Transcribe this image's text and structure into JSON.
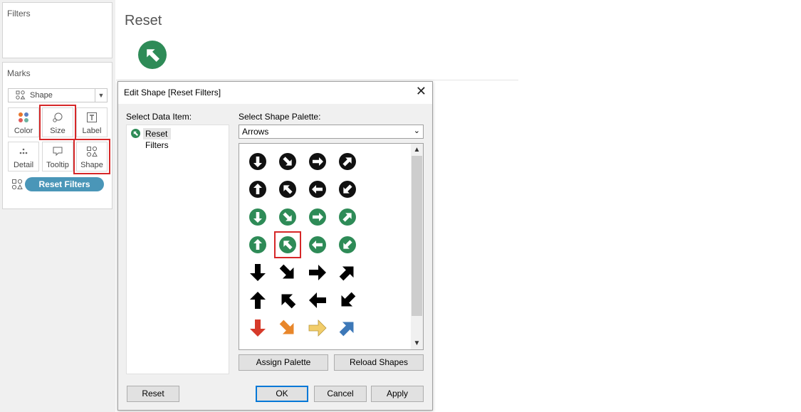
{
  "left_panel": {
    "filters_title": "Filters",
    "marks_title": "Marks",
    "mark_type": "Shape",
    "buttons": {
      "color": "Color",
      "size": "Size",
      "label": "Label",
      "detail": "Detail",
      "tooltip": "Tooltip",
      "shape": "Shape"
    },
    "pill_label": "Reset Filters"
  },
  "sheet": {
    "title": "Reset"
  },
  "dialog": {
    "title": "Edit Shape [Reset Filters]",
    "select_data_item_label": "Select Data Item:",
    "data_items": [
      "Reset Filters"
    ],
    "select_palette_label": "Select Shape Palette:",
    "palette_value": "Arrows",
    "buttons": {
      "assign_palette": "Assign Palette",
      "reload_shapes": "Reload Shapes",
      "reset": "Reset",
      "ok": "OK",
      "cancel": "Cancel",
      "apply": "Apply"
    }
  },
  "shapes": [
    {
      "name": "circle-arrow-down-black-icon",
      "style": "circle",
      "color": "#111111",
      "dir": 180
    },
    {
      "name": "circle-arrow-down-right-black-icon",
      "style": "circle",
      "color": "#111111",
      "dir": 135
    },
    {
      "name": "circle-arrow-right-black-icon",
      "style": "circle",
      "color": "#111111",
      "dir": 90
    },
    {
      "name": "circle-arrow-up-right-black-icon",
      "style": "circle",
      "color": "#111111",
      "dir": 45
    },
    {
      "name": "circle-arrow-up-black-icon",
      "style": "circle",
      "color": "#111111",
      "dir": 0
    },
    {
      "name": "circle-arrow-up-left-black-icon",
      "style": "circle",
      "color": "#111111",
      "dir": -45
    },
    {
      "name": "circle-arrow-left-black-icon",
      "style": "circle",
      "color": "#111111",
      "dir": -90
    },
    {
      "name": "circle-arrow-down-left-black-icon",
      "style": "circle",
      "color": "#111111",
      "dir": -135
    },
    {
      "name": "circle-arrow-down-green-icon",
      "style": "circle",
      "color": "#2e8b57",
      "dir": 180
    },
    {
      "name": "circle-arrow-down-right-green-icon",
      "style": "circle",
      "color": "#2e8b57",
      "dir": 135
    },
    {
      "name": "circle-arrow-right-green-icon",
      "style": "circle",
      "color": "#2e8b57",
      "dir": 90
    },
    {
      "name": "circle-arrow-up-right-green-icon",
      "style": "circle",
      "color": "#2e8b57",
      "dir": 45
    },
    {
      "name": "circle-arrow-up-green-icon",
      "style": "circle",
      "color": "#2e8b57",
      "dir": 0
    },
    {
      "name": "circle-arrow-up-left-green-icon",
      "style": "circle",
      "color": "#2e8b57",
      "dir": -45,
      "selected": true
    },
    {
      "name": "circle-arrow-left-green-icon",
      "style": "circle",
      "color": "#2e8b57",
      "dir": -90
    },
    {
      "name": "circle-arrow-down-left-green-icon",
      "style": "circle",
      "color": "#2e8b57",
      "dir": -135
    },
    {
      "name": "arrow-down-black-icon",
      "style": "solid",
      "color": "#000000",
      "dir": 180
    },
    {
      "name": "arrow-down-right-black-icon",
      "style": "solid",
      "color": "#000000",
      "dir": 135
    },
    {
      "name": "arrow-right-black-icon",
      "style": "solid",
      "color": "#000000",
      "dir": 90
    },
    {
      "name": "arrow-up-right-black-icon",
      "style": "solid",
      "color": "#000000",
      "dir": 45
    },
    {
      "name": "arrow-up-black-icon",
      "style": "solid",
      "color": "#000000",
      "dir": 0
    },
    {
      "name": "arrow-up-left-black-icon",
      "style": "solid",
      "color": "#000000",
      "dir": -45
    },
    {
      "name": "arrow-left-black-icon",
      "style": "solid",
      "color": "#000000",
      "dir": -90
    },
    {
      "name": "arrow-down-left-black-icon",
      "style": "solid",
      "color": "#000000",
      "dir": -135
    },
    {
      "name": "arrow-down-red-icon",
      "style": "solid",
      "color": "#d63a2a",
      "dir": 180
    },
    {
      "name": "arrow-down-right-orange-icon",
      "style": "solid",
      "color": "#e8862a",
      "dir": 135
    },
    {
      "name": "arrow-right-yellow-icon",
      "style": "solid",
      "color": "#f2cd6a",
      "dir": 90
    },
    {
      "name": "arrow-up-right-blue-icon",
      "style": "solid",
      "color": "#3d78b8",
      "dir": 45
    }
  ]
}
